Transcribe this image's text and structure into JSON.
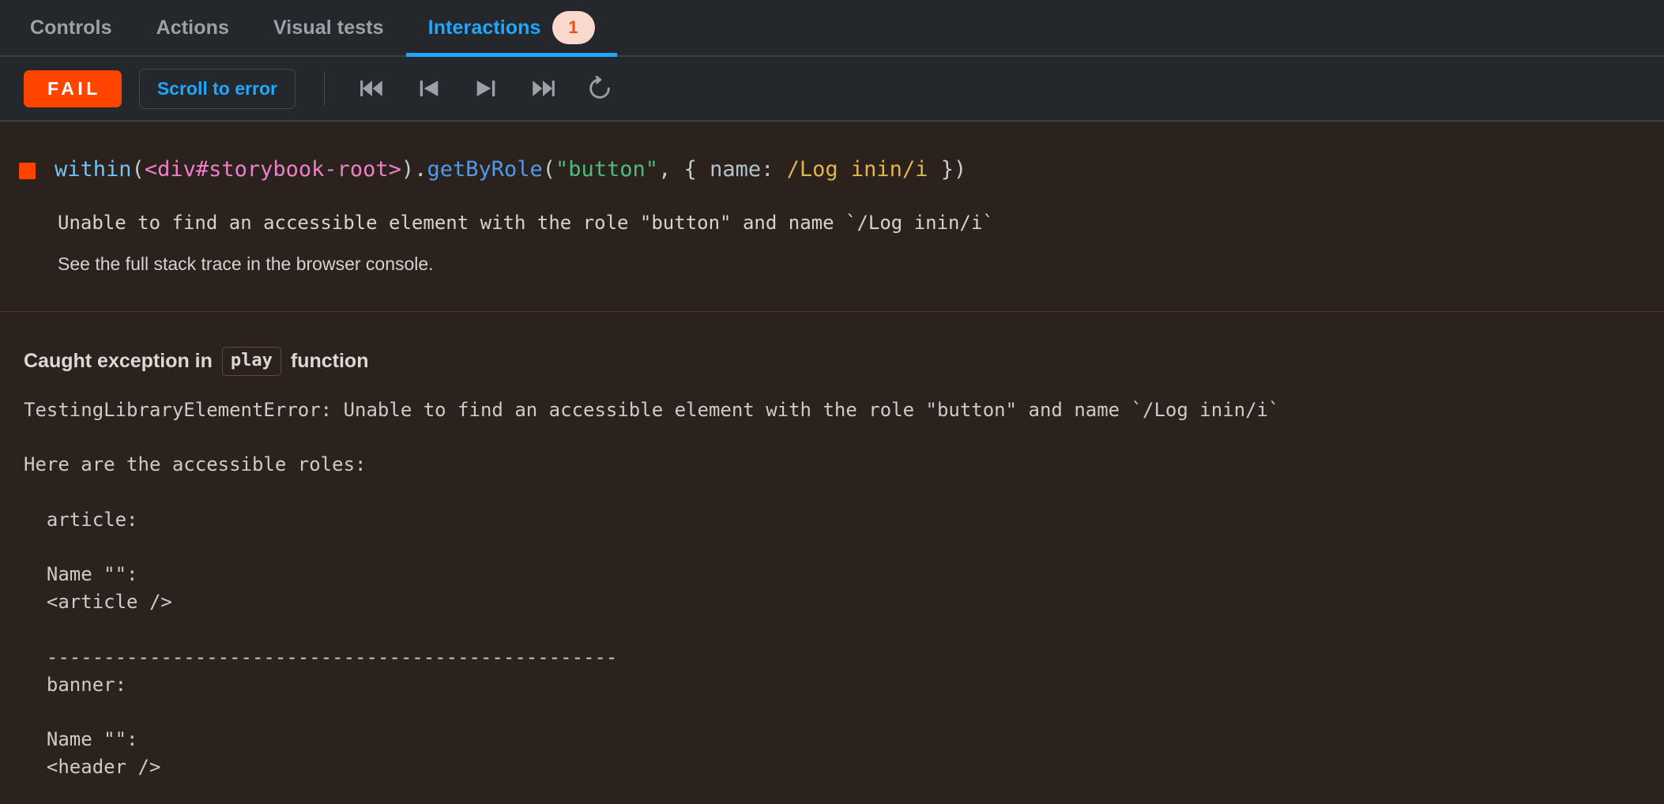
{
  "tabs": [
    {
      "label": "Controls",
      "active": false,
      "badge": null
    },
    {
      "label": "Actions",
      "active": false,
      "badge": null
    },
    {
      "label": "Visual tests",
      "active": false,
      "badge": null
    },
    {
      "label": "Interactions",
      "active": true,
      "badge": "1"
    }
  ],
  "toolbar": {
    "status_label": "FAIL",
    "scroll_label": "Scroll to error",
    "controls": [
      {
        "name": "go-to-start-button",
        "icon": "rewind-start-icon"
      },
      {
        "name": "step-back-button",
        "icon": "step-back-icon"
      },
      {
        "name": "step-forward-button",
        "icon": "step-forward-icon"
      },
      {
        "name": "go-to-end-button",
        "icon": "fast-forward-end-icon"
      },
      {
        "name": "rerun-button",
        "icon": "replay-icon"
      }
    ]
  },
  "interaction": {
    "status": "fail",
    "code": {
      "fn": "within",
      "open_paren": "(",
      "selector": "<div#storybook-root>",
      "close_method": ").",
      "method": "getByRole",
      "paren2": "(",
      "arg_string": "\"button\"",
      "comma": ", { ",
      "prop": "name:",
      "space": " ",
      "regex": "/Log inin/i",
      "tail": " })"
    },
    "message": "Unable to find an accessible element with the role \"button\" and name `/Log inin/i`",
    "note": "See the full stack trace in the browser console."
  },
  "exception": {
    "title_prefix": "Caught exception in",
    "chip": "play",
    "title_suffix": "function",
    "stack": "TestingLibraryElementError: Unable to find an accessible element with the role \"button\" and name `/Log inin/i`\n\nHere are the accessible roles:\n\n  article:\n\n  Name \"\":\n  <article />\n\n  --------------------------------------------------\n  banner:\n\n  Name \"\":\n  <header />"
  },
  "colors": {
    "accent_blue": "#1ea7fd",
    "fail_orange": "#ff4400",
    "badge_bg": "#fbd9cd",
    "badge_text": "#e8550d",
    "toolbar_bg": "#24282c",
    "panel_bg": "#2b221e"
  }
}
